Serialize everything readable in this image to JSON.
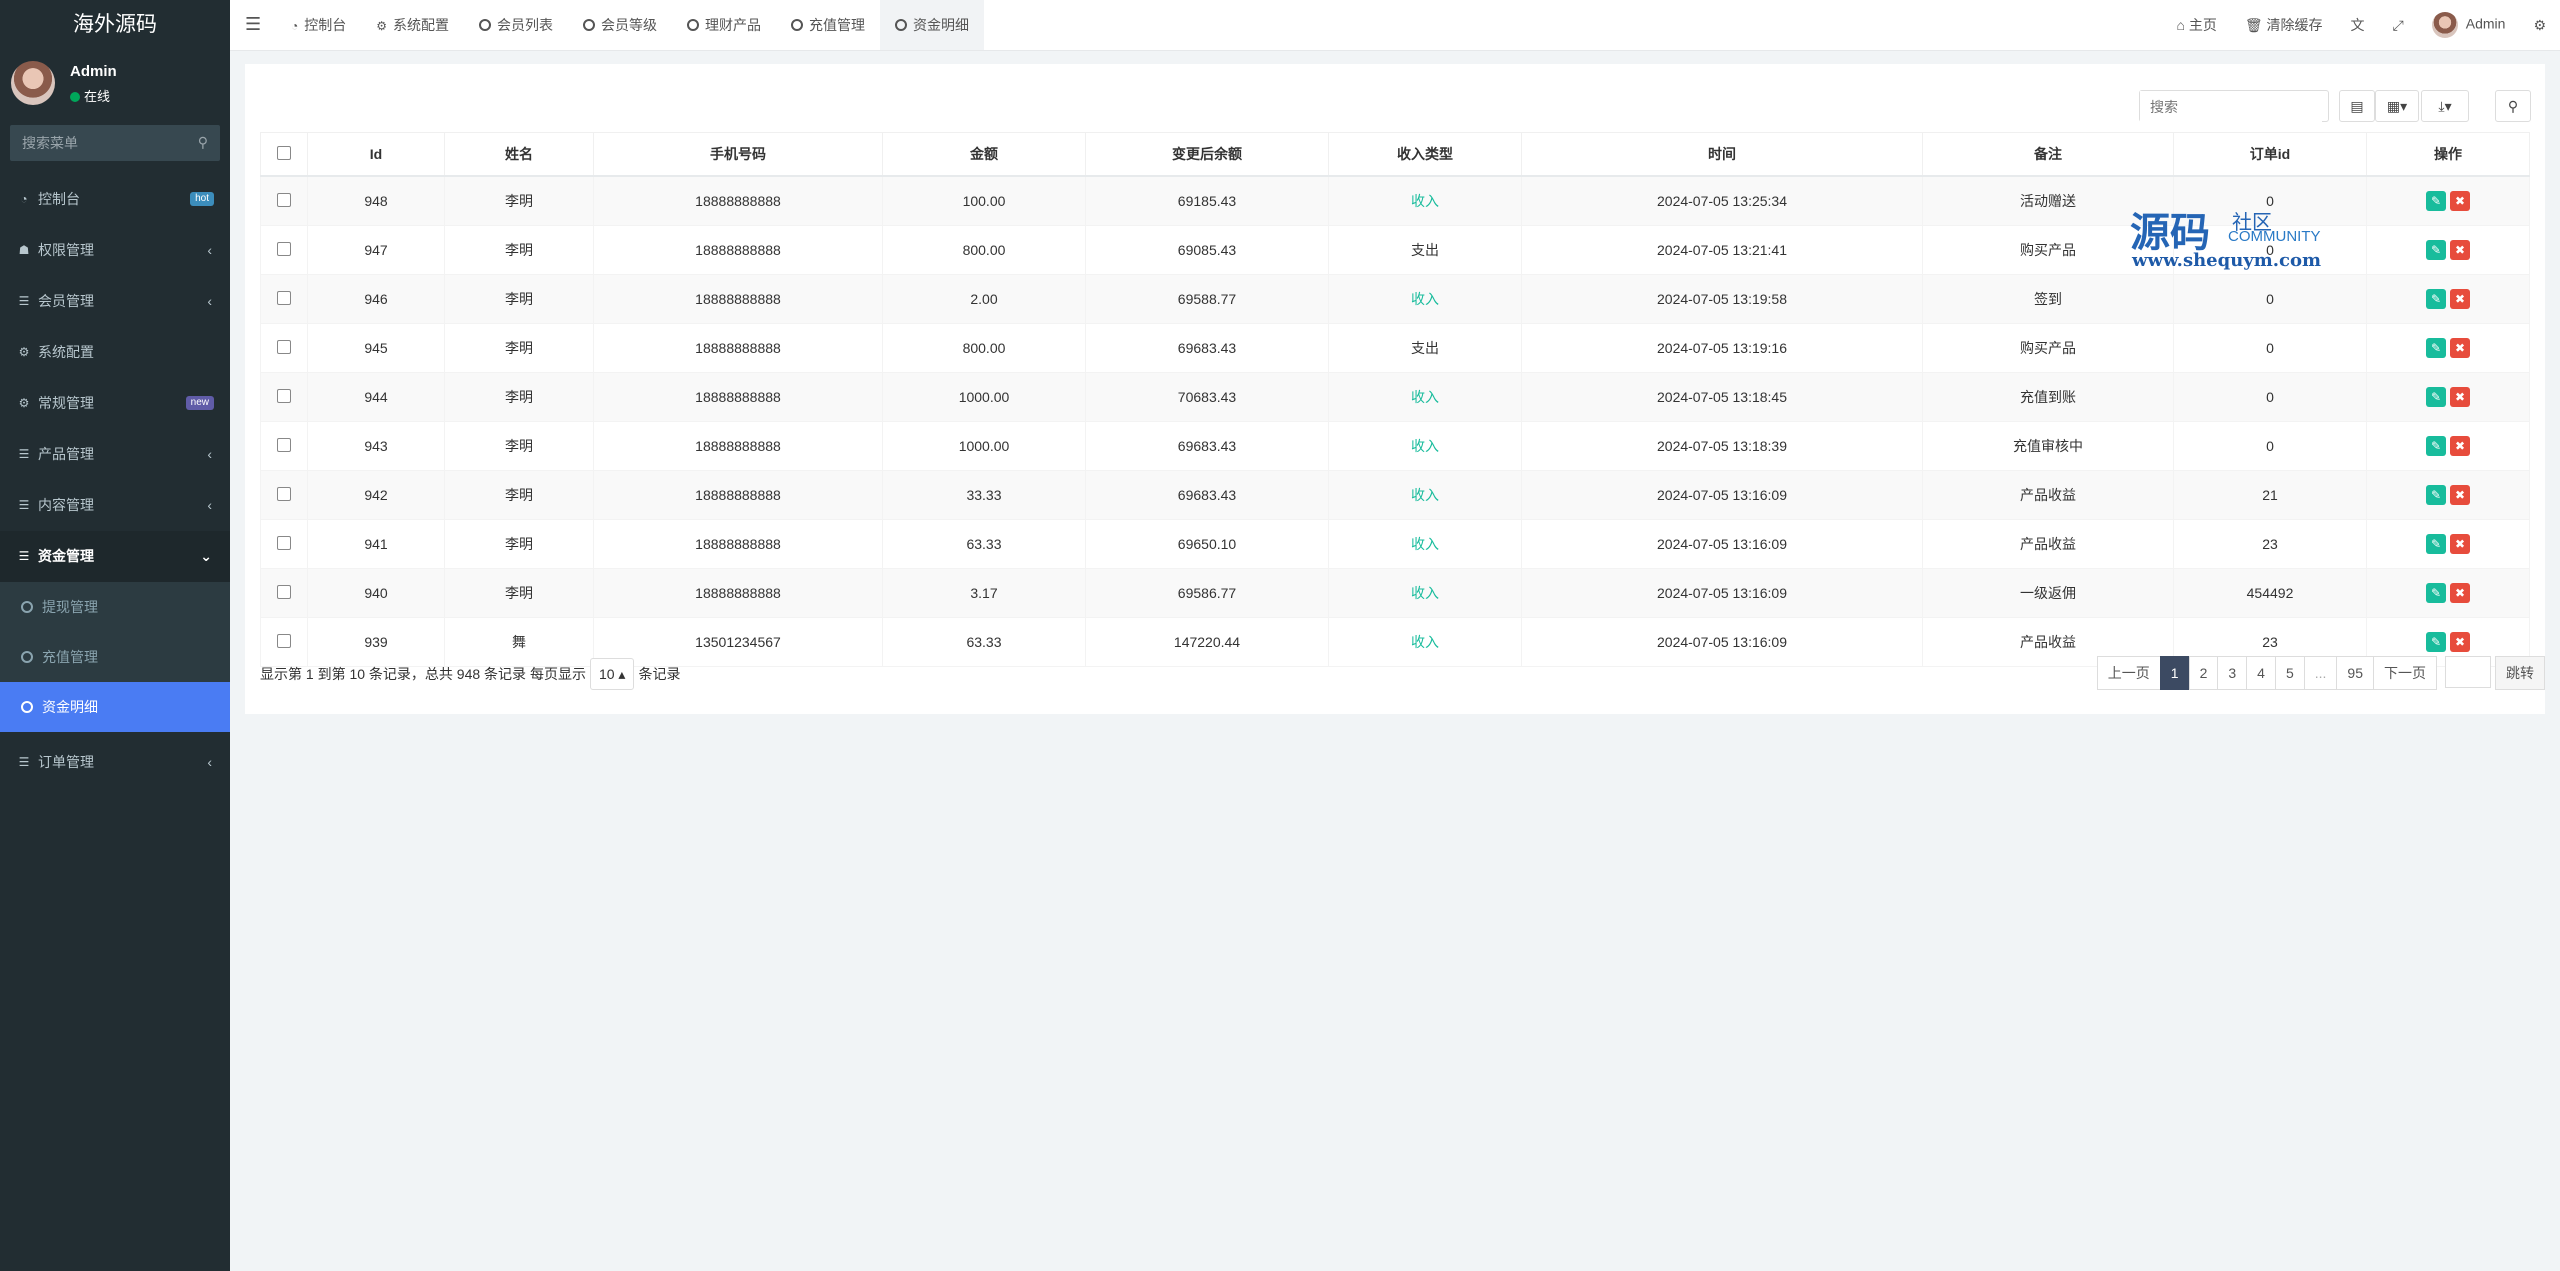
{
  "brand": "海外源码",
  "user": {
    "name": "Admin",
    "status": "在线"
  },
  "sidebar_search": {
    "placeholder": "搜索菜单"
  },
  "menu": [
    {
      "label": "控制台",
      "badge": "hot",
      "badge_color": "#3c8dbc"
    },
    {
      "label": "权限管理",
      "arrow": "‹"
    },
    {
      "label": "会员管理",
      "arrow": "‹"
    },
    {
      "label": "系统配置"
    },
    {
      "label": "常规管理",
      "badge": "new",
      "badge_color": "#605ca8"
    },
    {
      "label": "产品管理",
      "arrow": "‹"
    },
    {
      "label": "内容管理",
      "arrow": "‹"
    },
    {
      "label": "资金管理",
      "arrow": "⌄"
    }
  ],
  "submenu": [
    {
      "label": "提现管理"
    },
    {
      "label": "充值管理"
    },
    {
      "label": "资金明细"
    }
  ],
  "menu_after": {
    "label": "订单管理",
    "arrow": "‹"
  },
  "tabs": [
    "控制台",
    "系统配置",
    "会员列表",
    "会员等级",
    "理财产品",
    "充值管理",
    "资金明细"
  ],
  "topright": {
    "home": "主页",
    "clear_cache": "清除缓存",
    "admin": "Admin"
  },
  "toolbar": {
    "search_placeholder": "搜索"
  },
  "table": {
    "headers": [
      "Id",
      "姓名",
      "手机号码",
      "金额",
      "变更后余额",
      "收入类型",
      "时间",
      "备注",
      "订单id",
      "操作"
    ],
    "rows": [
      [
        "948",
        "李明",
        "18888888888",
        "100.00",
        "69185.43",
        "收入",
        "2024-07-05 13:25:34",
        "活动赠送",
        "0"
      ],
      [
        "947",
        "李明",
        "18888888888",
        "800.00",
        "69085.43",
        "支出",
        "2024-07-05 13:21:41",
        "购买产品",
        "0"
      ],
      [
        "946",
        "李明",
        "18888888888",
        "2.00",
        "69588.77",
        "收入",
        "2024-07-05 13:19:58",
        "签到",
        "0"
      ],
      [
        "945",
        "李明",
        "18888888888",
        "800.00",
        "69683.43",
        "支出",
        "2024-07-05 13:19:16",
        "购买产品",
        "0"
      ],
      [
        "944",
        "李明",
        "18888888888",
        "1000.00",
        "70683.43",
        "收入",
        "2024-07-05 13:18:45",
        "充值到账",
        "0"
      ],
      [
        "943",
        "李明",
        "18888888888",
        "1000.00",
        "69683.43",
        "收入",
        "2024-07-05 13:18:39",
        "充值审核中",
        "0"
      ],
      [
        "942",
        "李明",
        "18888888888",
        "33.33",
        "69683.43",
        "收入",
        "2024-07-05 13:16:09",
        "产品收益",
        "21"
      ],
      [
        "941",
        "李明",
        "18888888888",
        "63.33",
        "69650.10",
        "收入",
        "2024-07-05 13:16:09",
        "产品收益",
        "23"
      ],
      [
        "940",
        "李明",
        "18888888888",
        "3.17",
        "69586.77",
        "收入",
        "2024-07-05 13:16:09",
        "一级返佣",
        "454492"
      ],
      [
        "939",
        "舞",
        "13501234567",
        "63.33",
        "147220.44",
        "收入",
        "2024-07-05 13:16:09",
        "产品收益",
        "23"
      ]
    ]
  },
  "footer": {
    "info_prefix": "显示第 1 到第 10 条记录，总共 948 条记录 每页显示",
    "page_size": "10",
    "info_suffix": "条记录"
  },
  "pagination": {
    "prev": "上一页",
    "pages": [
      "1",
      "2",
      "3",
      "4",
      "5",
      "...",
      "95"
    ],
    "next": "下一页",
    "jump": "跳转"
  },
  "watermark": {
    "big": "源码",
    "small1": "社区",
    "small2": "COMMUNITY",
    "url": "www.shequym.com"
  },
  "colors": {
    "income": "#18bc9c",
    "active_menu": "#4a7cf3",
    "sidebar_bg": "#222d32",
    "current_page": "#3c4a62"
  }
}
